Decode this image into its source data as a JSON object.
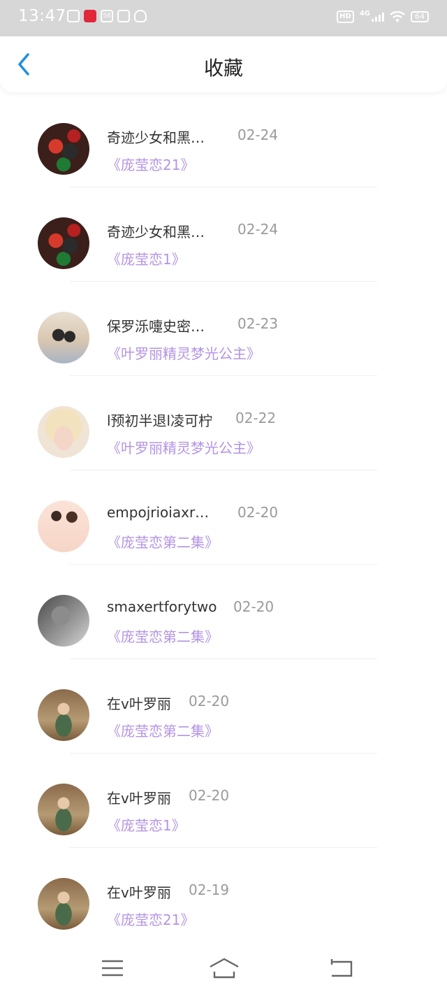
{
  "status_bar": {
    "time": "13:47",
    "app_labels": [
      "",
      "",
      "58",
      "",
      ""
    ],
    "hd": "HD",
    "network": "4G",
    "battery": "64"
  },
  "header": {
    "title": "收藏"
  },
  "items": [
    {
      "name": "奇迹少女和黑…",
      "date": "02-24",
      "work": "《庞莹恋21》"
    },
    {
      "name": "奇迹少女和黑…",
      "date": "02-24",
      "work": "《庞莹恋1》"
    },
    {
      "name": "保罗泺嚏史密…",
      "date": "02-23",
      "work": "《叶罗丽精灵梦光公主》"
    },
    {
      "name": "l预初半退l凌可柠",
      "date": "02-22",
      "work": "《叶罗丽精灵梦光公主》"
    },
    {
      "name": "empojrioiaxr…",
      "date": "02-20",
      "work": "《庞莹恋第二集》"
    },
    {
      "name": "smaxertforytwo",
      "date": "02-20",
      "work": "《庞莹恋第二集》"
    },
    {
      "name": "在v叶罗丽",
      "date": "02-20",
      "work": "《庞莹恋第二集》"
    },
    {
      "name": "在v叶罗丽",
      "date": "02-20",
      "work": "《庞莹恋1》"
    },
    {
      "name": "在v叶罗丽",
      "date": "02-19",
      "work": "《庞莹恋21》"
    }
  ],
  "colors": {
    "accent_blue": "#1e8fe0",
    "work_purple": "#b494e3",
    "date_gray": "#9a9a9a"
  },
  "icons": {
    "back": "chevron-left-icon",
    "menu": "menu-icon",
    "home": "home-icon",
    "return": "back-icon"
  }
}
